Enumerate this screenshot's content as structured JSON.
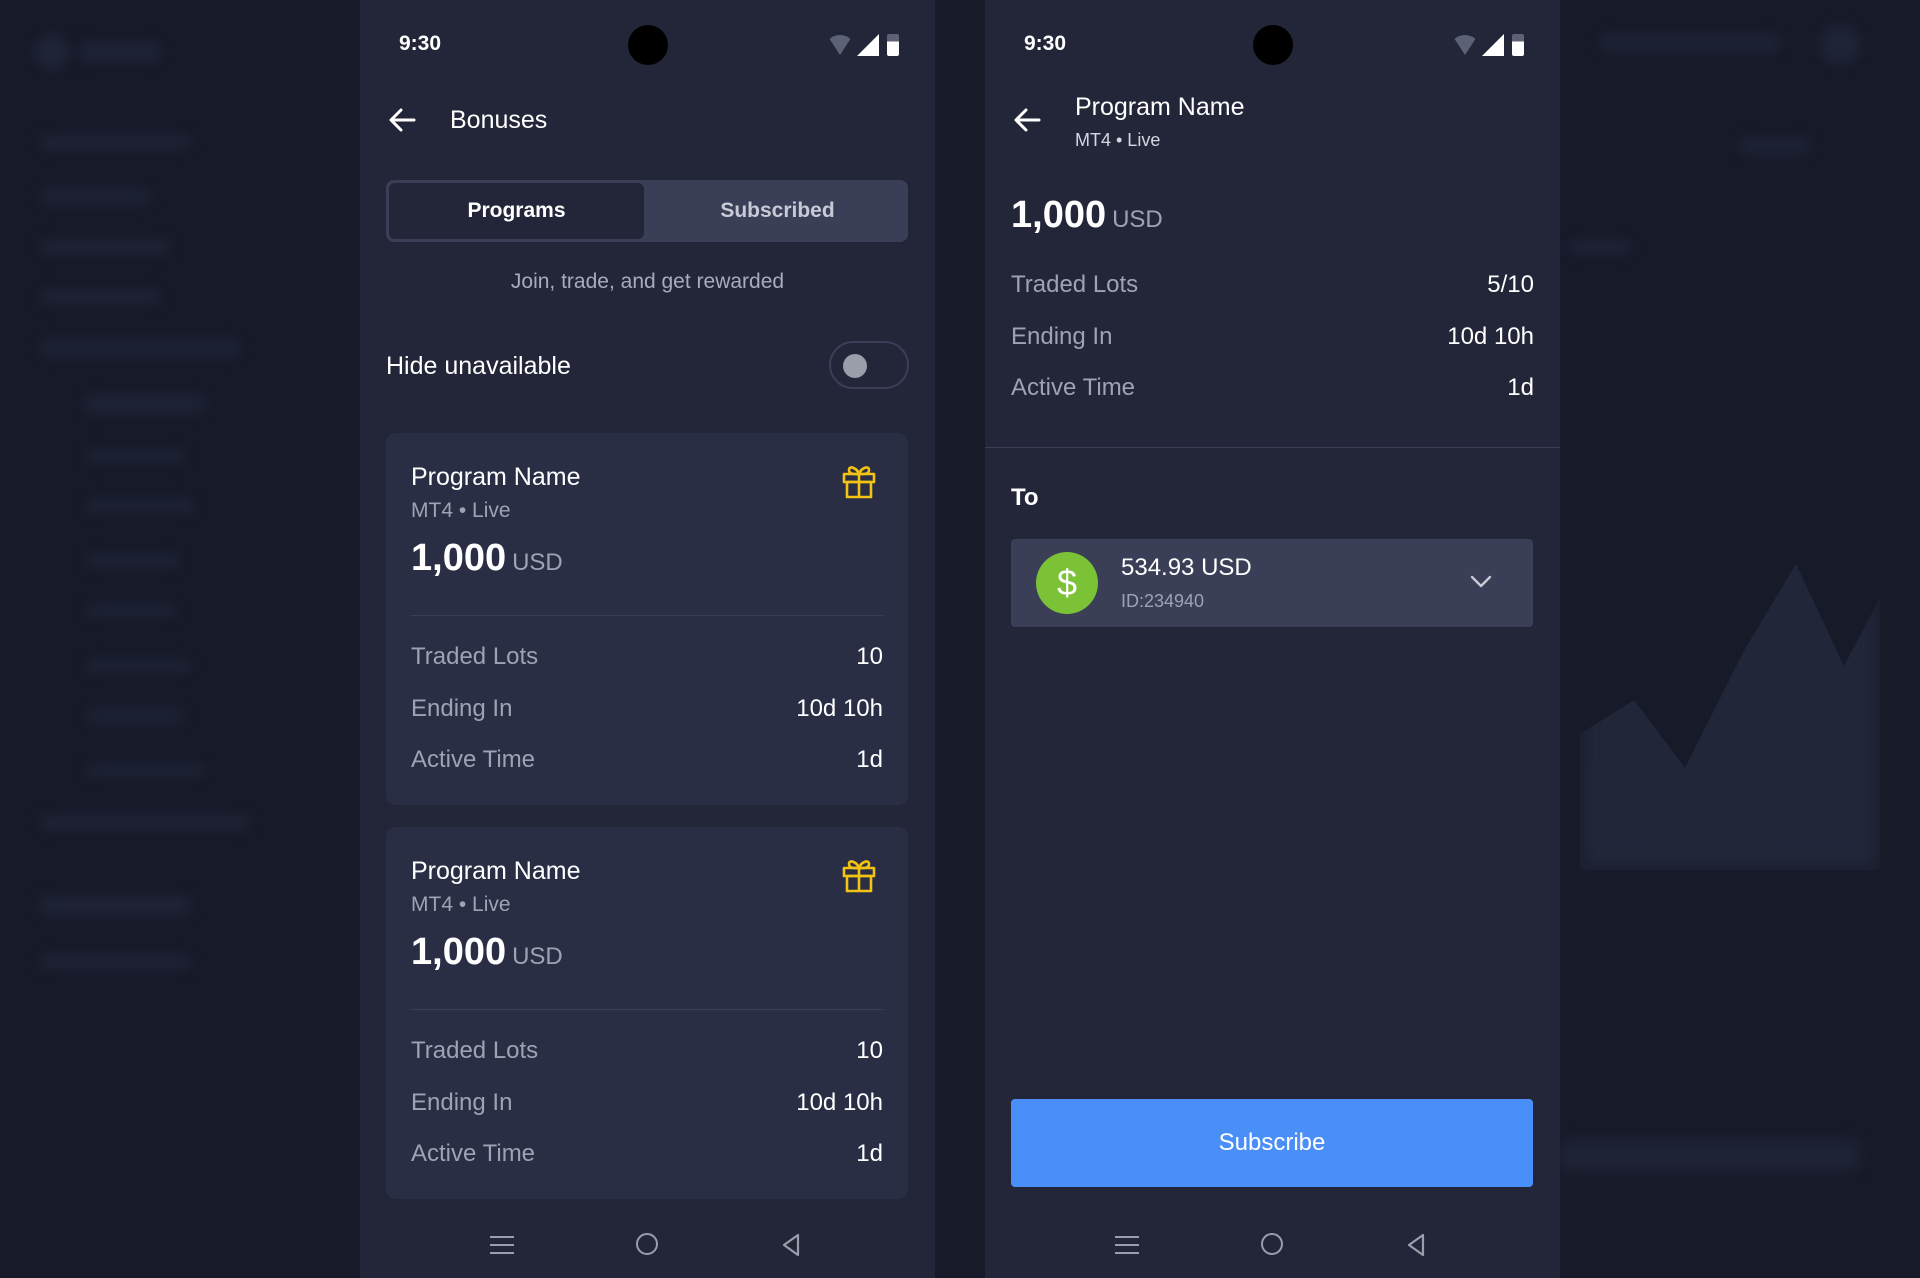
{
  "status_bar": {
    "time": "9:30"
  },
  "bonuses_screen": {
    "title": "Bonuses",
    "tabs": [
      {
        "label": "Programs",
        "active": true
      },
      {
        "label": "Subscribed",
        "active": false
      }
    ],
    "subtitle": "Join, trade, and get rewarded",
    "hide_unavailable": {
      "label": "Hide unavailable",
      "on": false
    },
    "programs": [
      {
        "name": "Program Name",
        "platform": "MT4 • Live",
        "amount": "1,000",
        "currency": "USD",
        "rows": [
          {
            "label": "Traded Lots",
            "value": "10"
          },
          {
            "label": "Ending In",
            "value": "10d 10h"
          },
          {
            "label": "Active Time",
            "value": "1d"
          }
        ]
      },
      {
        "name": "Program Name",
        "platform": "MT4 • Live",
        "amount": "1,000",
        "currency": "USD",
        "rows": [
          {
            "label": "Traded Lots",
            "value": "10"
          },
          {
            "label": "Ending In",
            "value": "10d 10h"
          },
          {
            "label": "Active Time",
            "value": "1d"
          }
        ]
      }
    ]
  },
  "program_screen": {
    "title": "Program Name",
    "subtitle": "MT4 • Live",
    "amount": "1,000",
    "currency": "USD",
    "rows": [
      {
        "label": "Traded Lots",
        "value": "5/10"
      },
      {
        "label": "Ending In",
        "value": "10d 10h"
      },
      {
        "label": "Active Time",
        "value": "1d"
      }
    ],
    "to_label": "To",
    "account": {
      "icon": "$",
      "balance": "534.93 USD",
      "id": "ID:234940"
    },
    "subscribe_label": "Subscribe"
  },
  "colors": {
    "background": "#161a29",
    "phone": "#232638",
    "card": "#2a2e45",
    "accent": "#4a8ff7",
    "gift": "#f2c313",
    "account_icon": "#7bc236"
  }
}
